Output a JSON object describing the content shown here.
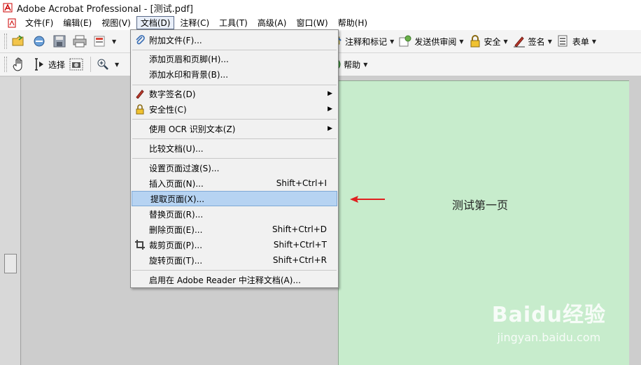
{
  "window": {
    "title": "Adobe Acrobat Professional - [测试.pdf]"
  },
  "menubar": {
    "items": [
      "文件(F)",
      "编辑(E)",
      "视图(V)",
      "文档(D)",
      "注释(C)",
      "工具(T)",
      "高级(A)",
      "窗口(W)",
      "帮助(H)"
    ],
    "active": "文档(D)"
  },
  "toolbar1": {
    "annotate": "注释和标记",
    "send_review": "发送供审阅",
    "security": "安全",
    "sign": "签名",
    "forms": "表单"
  },
  "toolbar2": {
    "select": "选择",
    "help": "帮助"
  },
  "document_menu": {
    "items": [
      {
        "label": "附加文件(F)...",
        "icon": "paperclip-icon"
      },
      {
        "label": "添加页眉和页脚(H)..."
      },
      {
        "label": "添加水印和背景(B)..."
      },
      {
        "label": "数字签名(D)",
        "icon": "pen-icon",
        "submenu": true
      },
      {
        "label": "安全性(C)",
        "icon": "lock-icon",
        "submenu": true
      },
      {
        "label": "使用 OCR 识别文本(Z)",
        "submenu": true
      },
      {
        "label": "比较文档(U)..."
      },
      {
        "label": "设置页面过渡(S)..."
      },
      {
        "label": "插入页面(N)...",
        "shortcut": "Shift+Ctrl+I"
      },
      {
        "label": "提取页面(X)...",
        "highlighted": true
      },
      {
        "label": "替换页面(R)..."
      },
      {
        "label": "删除页面(E)...",
        "shortcut": "Shift+Ctrl+D"
      },
      {
        "label": "裁剪页面(P)...",
        "icon": "crop-icon",
        "shortcut": "Shift+Ctrl+T"
      },
      {
        "label": "旋转页面(T)...",
        "shortcut": "Shift+Ctrl+R"
      },
      {
        "label": "启用在 Adobe Reader 中注释文档(A)..."
      }
    ]
  },
  "page": {
    "text": "测试第一页"
  },
  "watermark": {
    "main": "Baidu经验",
    "sub": "jingyan.baidu.com"
  },
  "colors": {
    "highlight": "#b6d3f2",
    "page": "#c7eccc",
    "arrow": "#e02020"
  }
}
